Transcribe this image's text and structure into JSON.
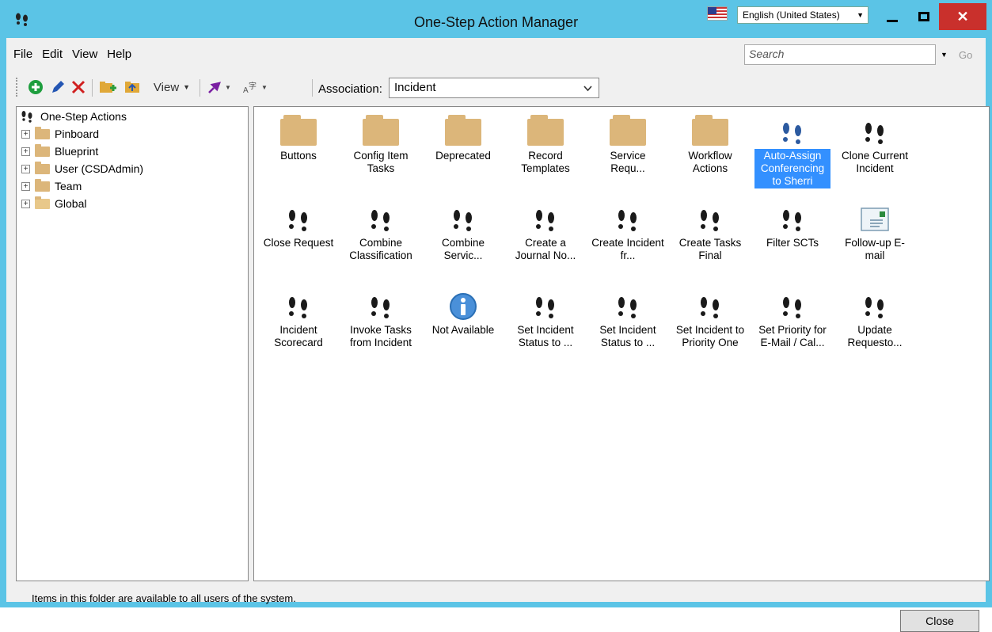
{
  "window": {
    "title": "One-Step Action Manager",
    "language": "English (United States)"
  },
  "menu": [
    "File",
    "Edit",
    "View",
    "Help"
  ],
  "search": {
    "placeholder": "Search",
    "go_label": "Go"
  },
  "toolbar": {
    "view_label": "View",
    "association_label": "Association:",
    "association_value": "Incident"
  },
  "tree": {
    "root": "One-Step Actions",
    "items": [
      "Pinboard",
      "Blueprint",
      "User (CSDAdmin)",
      "Team",
      "Global"
    ]
  },
  "tiles": [
    {
      "label": "Buttons",
      "icon": "folder"
    },
    {
      "label": "Config Item Tasks",
      "icon": "folder"
    },
    {
      "label": "Deprecated",
      "icon": "folder"
    },
    {
      "label": "Record Templates",
      "icon": "folder"
    },
    {
      "label": "Service Requ...",
      "icon": "folder"
    },
    {
      "label": "Workflow Actions",
      "icon": "folder"
    },
    {
      "label": "Auto-Assign Conferencing to Sherri",
      "icon": "footprints-blue",
      "selected": true
    },
    {
      "label": "Clone Current Incident",
      "icon": "footprints"
    },
    {
      "label": "Close Request",
      "icon": "footprints"
    },
    {
      "label": "Combine Classification",
      "icon": "footprints"
    },
    {
      "label": "Combine Servic...",
      "icon": "footprints"
    },
    {
      "label": "Create a Journal No...",
      "icon": "footprints"
    },
    {
      "label": "Create Incident fr...",
      "icon": "footprints"
    },
    {
      "label": "Create Tasks Final",
      "icon": "footprints"
    },
    {
      "label": "Filter SCTs",
      "icon": "footprints"
    },
    {
      "label": "Follow-up E-mail",
      "icon": "email"
    },
    {
      "label": "Incident Scorecard",
      "icon": "footprints"
    },
    {
      "label": "Invoke Tasks from Incident",
      "icon": "footprints"
    },
    {
      "label": "Not Available",
      "icon": "info"
    },
    {
      "label": "Set Incident Status to ...",
      "icon": "footprints"
    },
    {
      "label": "Set Incident Status to ...",
      "icon": "footprints"
    },
    {
      "label": "Set Incident to Priority One",
      "icon": "footprints"
    },
    {
      "label": "Set Priority for E-Mail / Cal...",
      "icon": "footprints"
    },
    {
      "label": "Update Requesto...",
      "icon": "footprints"
    }
  ],
  "status": "Items in this folder are available to all users of the system.",
  "close_label": "Close"
}
